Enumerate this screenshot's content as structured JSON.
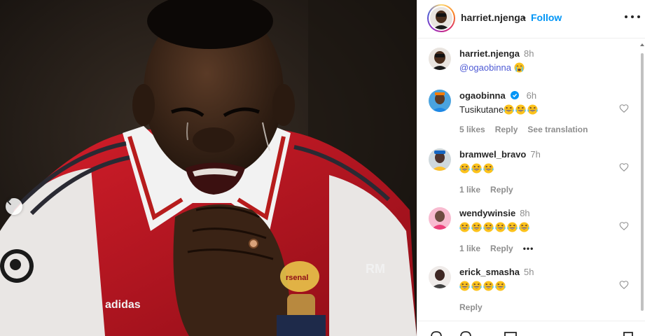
{
  "post": {
    "author": "harriet.njenga",
    "dot": "•",
    "follow_label": "Follow",
    "caption": {
      "user": "harriet.njenga",
      "time": "8h",
      "mention": "@ogaobinna",
      "emoji": "crying-face"
    }
  },
  "comments": [
    {
      "user": "ogaobinna",
      "verified": true,
      "time": "6h",
      "text": "Tusikutane",
      "emojis": 3,
      "likes": "5 likes",
      "reply": "Reply",
      "translate": "See translation"
    },
    {
      "user": "bramwel_bravo",
      "verified": false,
      "time": "7h",
      "text": "",
      "emojis": 3,
      "likes": "1 like",
      "reply": "Reply"
    },
    {
      "user": "wendywinsie",
      "verified": false,
      "time": "8h",
      "text": "",
      "emojis": 6,
      "likes": "1 like",
      "reply": "Reply",
      "more": "•••"
    },
    {
      "user": "erick_smasha",
      "verified": false,
      "time": "5h",
      "text": "",
      "emojis": 4,
      "reply": "Reply"
    }
  ],
  "icons": {
    "prev": "chevron-left-icon",
    "more": "more-options-icon",
    "heart": "heart-icon",
    "verified": "verified-badge-icon",
    "emoji": "laughing-tears-emoji"
  },
  "colors": {
    "follow": "#0095f6",
    "mention": "#4f5bd5",
    "jersey_red": "#c8102e"
  }
}
